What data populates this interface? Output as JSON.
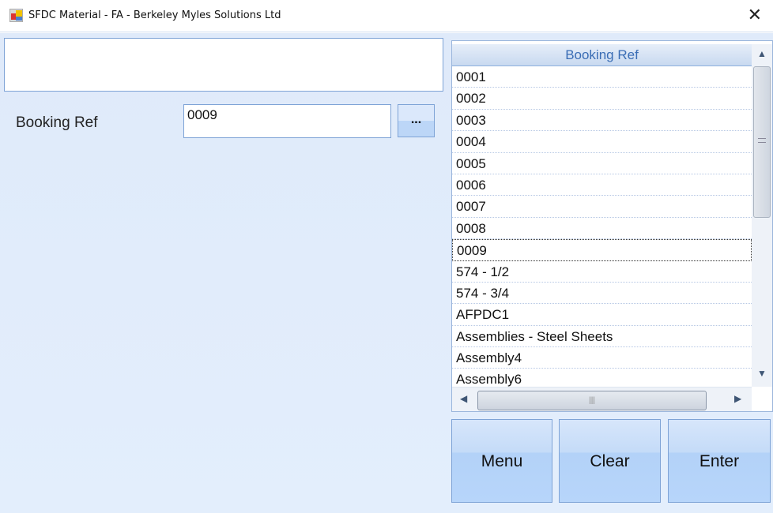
{
  "window": {
    "title": "SFDC Material - FA - Berkeley Myles Solutions Ltd",
    "close_glyph": "✕"
  },
  "form": {
    "booking_ref_label": "Booking Ref",
    "booking_ref_value": "0009",
    "browse_label": "..."
  },
  "grid": {
    "header": "Booking Ref",
    "selected": "0009",
    "rows": [
      "0001",
      "0002",
      "0003",
      "0004",
      "0005",
      "0006",
      "0007",
      "0008",
      "0009",
      "574 - 1/2",
      "574 - 3/4",
      "AFPDC1",
      "Assemblies - Steel Sheets",
      "Assembly4",
      "Assembly6"
    ]
  },
  "buttons": {
    "menu": "Menu",
    "clear": "Clear",
    "enter": "Enter"
  }
}
